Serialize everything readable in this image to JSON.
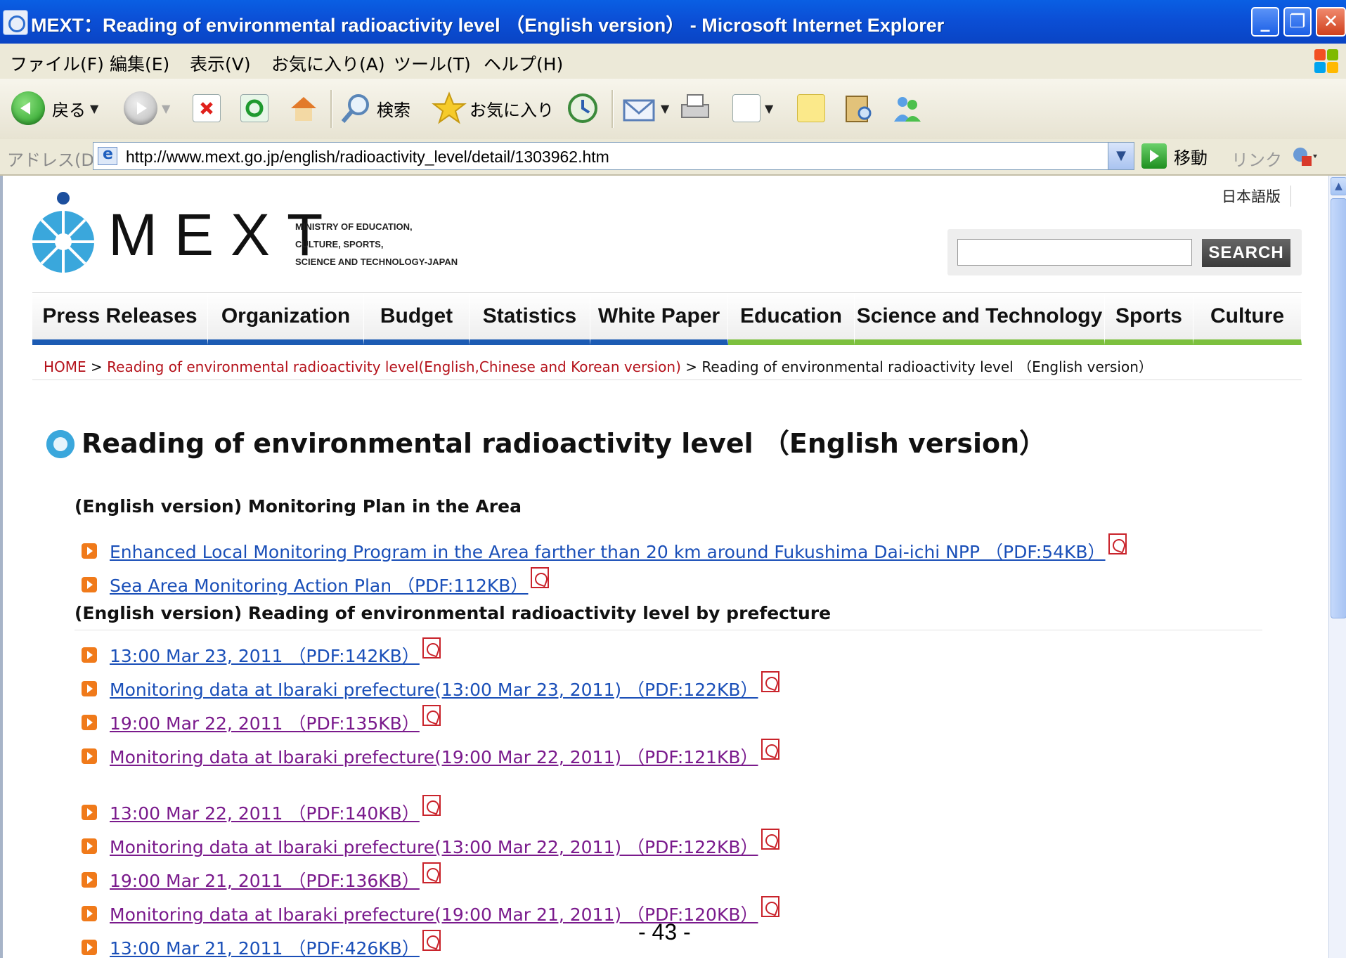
{
  "window": {
    "title": "MEXT：Reading of environmental radioactivity level （English version） - Microsoft Internet Explorer",
    "min_glyph": "_",
    "max_glyph": "❐",
    "close_glyph": "✕"
  },
  "menu": [
    "ファイル(F)",
    "編集(E)",
    "表示(V)",
    "お気に入り(A)",
    "ツール(T)",
    "ヘルプ(H)"
  ],
  "toolbar": {
    "back_label": "戻る",
    "search_label": "検索",
    "favorites_label": "お気に入り"
  },
  "address": {
    "label": "アドレス(D)",
    "url": "http://www.mext.go.jp/english/radioactivity_level/detail/1303962.htm",
    "go_label": "移動",
    "links_label": "リンク"
  },
  "site": {
    "lang_link": "日本語版",
    "logo_text": "MEXT",
    "logo_sub_1": "MINISTRY OF EDUCATION,",
    "logo_sub_2": "CULTURE, SPORTS,",
    "logo_sub_3": "SCIENCE AND TECHNOLOGY-JAPAN",
    "search_button": "SEARCH",
    "search_value": ""
  },
  "nav": [
    {
      "label": "Press Releases",
      "accent": "#1c5bb3"
    },
    {
      "label": "Organization",
      "accent": "#1c5bb3"
    },
    {
      "label": "Budget",
      "accent": "#1c5bb3"
    },
    {
      "label": "Statistics",
      "accent": "#1c5bb3"
    },
    {
      "label": "White Paper",
      "accent": "#1c5bb3"
    },
    {
      "label": "Education",
      "accent": "#7cc03e"
    },
    {
      "label": "Science and Technology",
      "accent": "#7cc03e"
    },
    {
      "label": "Sports",
      "accent": "#7cc03e"
    },
    {
      "label": "Culture",
      "accent": "#7cc03e"
    }
  ],
  "breadcrumb": {
    "home": "HOME",
    "sep": " > ",
    "parent": "Reading of environmental radioactivity level(English,Chinese and Korean version)",
    "current": "Reading of environmental radioactivity level （English version）"
  },
  "page_title": "Reading of environmental radioactivity level （English version）",
  "sections": [
    {
      "heading": "(English version) Monitoring Plan in the Area",
      "links": [
        {
          "text": "Enhanced Local Monitoring Program in the Area farther than 20 km around Fukushima Dai-ichi NPP （PDF:54KB）",
          "visited": false
        },
        {
          "text": "Sea Area Monitoring Action Plan （PDF:112KB）",
          "visited": false
        }
      ]
    },
    {
      "heading": "(English version) Reading of environmental radioactivity level by prefecture",
      "links": [
        {
          "text": "13:00 Mar 23, 2011 （PDF:142KB）",
          "visited": false
        },
        {
          "text": "Monitoring data at Ibaraki prefecture(13:00 Mar 23, 2011) （PDF:122KB）",
          "visited": false
        },
        {
          "text": "19:00 Mar 22, 2011 （PDF:135KB）",
          "visited": true
        },
        {
          "text": "Monitoring data at Ibaraki prefecture(19:00 Mar 22, 2011) （PDF:121KB）",
          "visited": true
        },
        {
          "text": "13:00 Mar 22, 2011 （PDF:140KB）",
          "visited": true
        },
        {
          "text": "Monitoring data at Ibaraki prefecture(13:00 Mar 22, 2011) （PDF:122KB）",
          "visited": true
        },
        {
          "text": "19:00 Mar 21, 2011 （PDF:136KB）",
          "visited": true
        },
        {
          "text": "Monitoring data at Ibaraki prefecture(19:00 Mar 21, 2011) （PDF:120KB）",
          "visited": true
        },
        {
          "text": "13:00 Mar 21, 2011 （PDF:426KB）",
          "visited": false
        }
      ]
    }
  ],
  "page_number": "- 43 -",
  "colors": {
    "link": "#1a4fb8",
    "visited": "#7a1a8c",
    "breadcrumb_link": "#b5121b",
    "bullet": "#f07a1a"
  }
}
